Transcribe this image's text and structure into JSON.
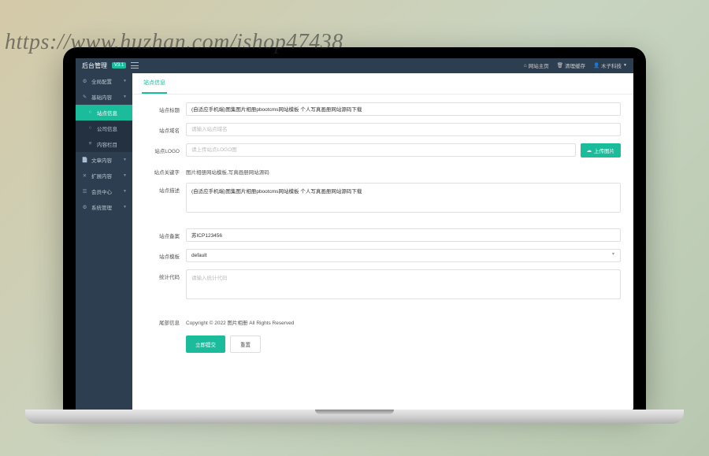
{
  "watermark": "https://www.huzhan.com/ishop47438",
  "brand": {
    "title": "后台管理",
    "version": "V3.1"
  },
  "toplinks": {
    "home": "网站主页",
    "cache": "清理缓存",
    "user": "木子科技"
  },
  "sidebar": [
    {
      "icon": "⚙",
      "label": "全局配置",
      "expandable": true,
      "type": "top"
    },
    {
      "icon": "✎",
      "label": "基础内容",
      "expandable": true,
      "type": "top"
    },
    {
      "icon": "○",
      "label": "站点信息",
      "type": "sub",
      "active": true
    },
    {
      "icon": "○",
      "label": "公司信息",
      "type": "sub"
    },
    {
      "icon": "≡",
      "label": "内容栏目",
      "type": "sub"
    },
    {
      "icon": "📄",
      "label": "文章内容",
      "expandable": true,
      "type": "top"
    },
    {
      "icon": "✕",
      "label": "扩展内容",
      "expandable": true,
      "type": "top"
    },
    {
      "icon": "☰",
      "label": "会员中心",
      "expandable": true,
      "type": "top"
    },
    {
      "icon": "⚙",
      "label": "系统管理",
      "expandable": true,
      "type": "top"
    }
  ],
  "tab": "站点信息",
  "form": {
    "title_label": "站点标题",
    "title_value": "(自适应手机端)图集图片相册pbootcms网站模板 个人写真画册网站源码下载",
    "domain_label": "站点域名",
    "domain_placeholder": "请输入站点域名",
    "logo_label": "站点LOGO",
    "logo_placeholder": "请上传站点LOGO图",
    "upload_btn": "上传图片",
    "keywords_label": "站点关键字",
    "keywords_value": "图片相册网站模板,写真画册网站源码",
    "desc_label": "站点描述",
    "desc_value": "(自适应手机端)图集图片相册pbootcms网站模板 个人写真画册网站源码下载",
    "icp_label": "站点备案",
    "icp_value": "苏ICP123456",
    "template_label": "站点模板",
    "template_value": "default",
    "stats_label": "统计代码",
    "stats_placeholder": "请输入统计代码",
    "copyright_label": "尾部信息",
    "copyright_value": "Copyright © 2022 图片相册 All Rights Reserved",
    "submit": "立即提交",
    "reset": "重置"
  }
}
